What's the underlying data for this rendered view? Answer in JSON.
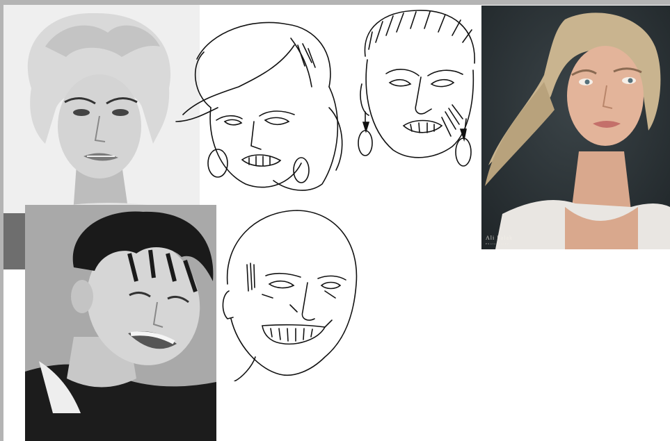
{
  "canvas": {
    "background": "#ffffff",
    "frame_color": "#b4b4b4"
  },
  "references": [
    {
      "kind": "photo",
      "subject": "3d render of a woman with platinum curly hair, grimacing",
      "tone": "grayscale"
    },
    {
      "kind": "photo",
      "subject": "young man with dark messy hair laughing",
      "tone": "grayscale"
    },
    {
      "kind": "photo",
      "subject": "blonde woman with freckles glancing sideways",
      "tone": "color",
      "watermark": {
        "name": "Ali Falak",
        "sub": "Photography"
      }
    }
  ],
  "sketches": [
    {
      "subject": "woman-head-sketch",
      "style": "black ink line art"
    },
    {
      "subject": "man-head-sketch",
      "style": "black ink line art"
    },
    {
      "subject": "bald-head-sketch",
      "style": "black ink line art"
    }
  ],
  "colors": {
    "ink": "#111111",
    "photo_left_bg": "#f0f0f0",
    "photo_bottom_bg": "#a8a8a8",
    "photo_right_bg": "#2c3438"
  }
}
